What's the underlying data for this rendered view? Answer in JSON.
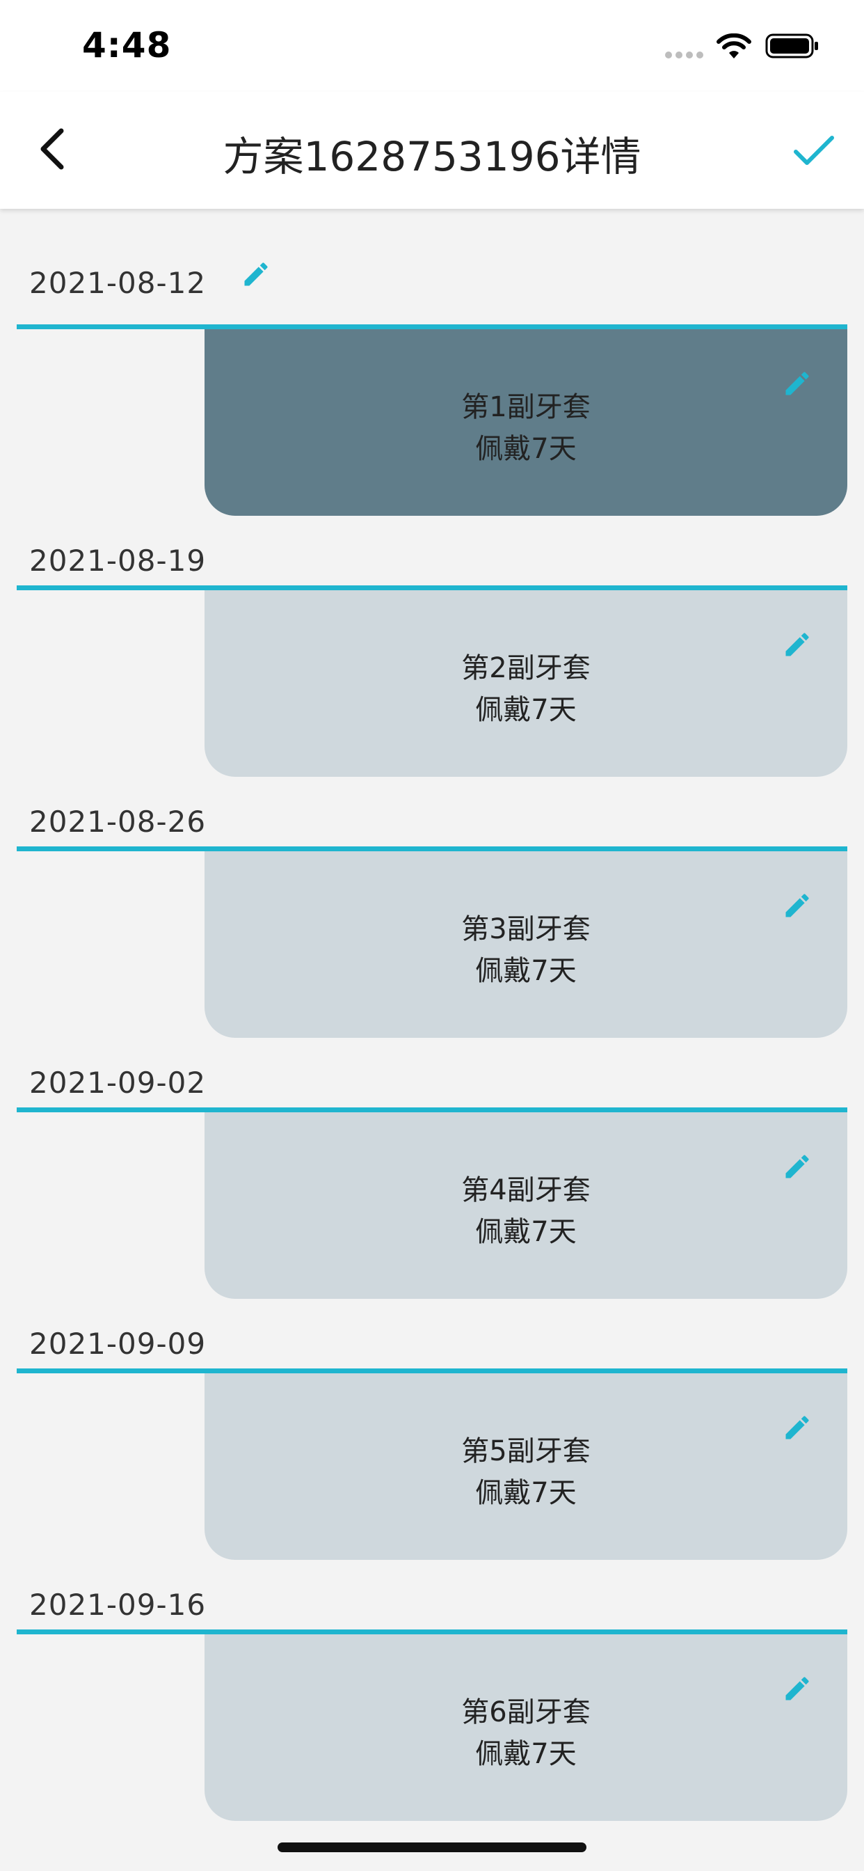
{
  "status_bar": {
    "time": "4:48"
  },
  "nav": {
    "title": "方案1628753196详情",
    "back_icon": "chevron-left-icon",
    "confirm_icon": "checkmark-icon"
  },
  "colors": {
    "accent": "#1fb5cf",
    "card_default": "#cfd8dd",
    "card_active": "#607d8a",
    "background": "#f3f3f3"
  },
  "entries": [
    {
      "date": "2021-08-12",
      "stage": "第1副牙套",
      "duration": "佩戴7天",
      "active": true
    },
    {
      "date": "2021-08-19",
      "stage": "第2副牙套",
      "duration": "佩戴7天",
      "active": false
    },
    {
      "date": "2021-08-26",
      "stage": "第3副牙套",
      "duration": "佩戴7天",
      "active": false
    },
    {
      "date": "2021-09-02",
      "stage": "第4副牙套",
      "duration": "佩戴7天",
      "active": false
    },
    {
      "date": "2021-09-09",
      "stage": "第5副牙套",
      "duration": "佩戴7天",
      "active": false
    },
    {
      "date": "2021-09-16",
      "stage": "第6副牙套",
      "duration": "佩戴7天",
      "active": false
    }
  ]
}
